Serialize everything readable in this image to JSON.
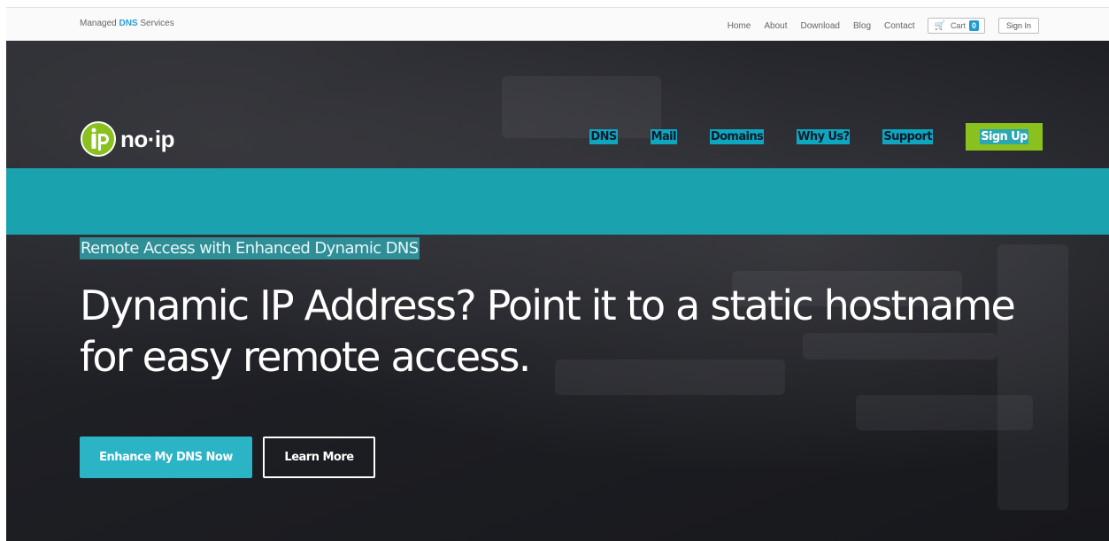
{
  "topbar": {
    "tagline_pre": "Managed",
    "tagline_dns": "DNS",
    "tagline_post": "Services",
    "links": [
      "Home",
      "About",
      "Download",
      "Blog",
      "Contact"
    ],
    "cart_label": "Cart",
    "cart_count": "0",
    "sign_in": "Sign In"
  },
  "logo": {
    "text": "no·ip"
  },
  "nav": {
    "items": [
      "DNS",
      "Mail",
      "Domains",
      "Why Us?",
      "Support"
    ],
    "signup": "Sign Up"
  },
  "hero": {
    "eyebrow": "Remote Access with Enhanced Dynamic DNS",
    "headline": "Dynamic IP Address? Point it to a static hostname for easy remote access.",
    "primary_cta": "Enhance My DNS Now",
    "secondary_cta": "Learn More"
  },
  "colors": {
    "teal_band": "#1aa3ae",
    "signup_green": "#8bc11e",
    "primary_button": "#2bb3c6",
    "cart_badge": "#1f9bd1"
  },
  "icons": [
    "cart-icon",
    "noip-logo-icon"
  ]
}
